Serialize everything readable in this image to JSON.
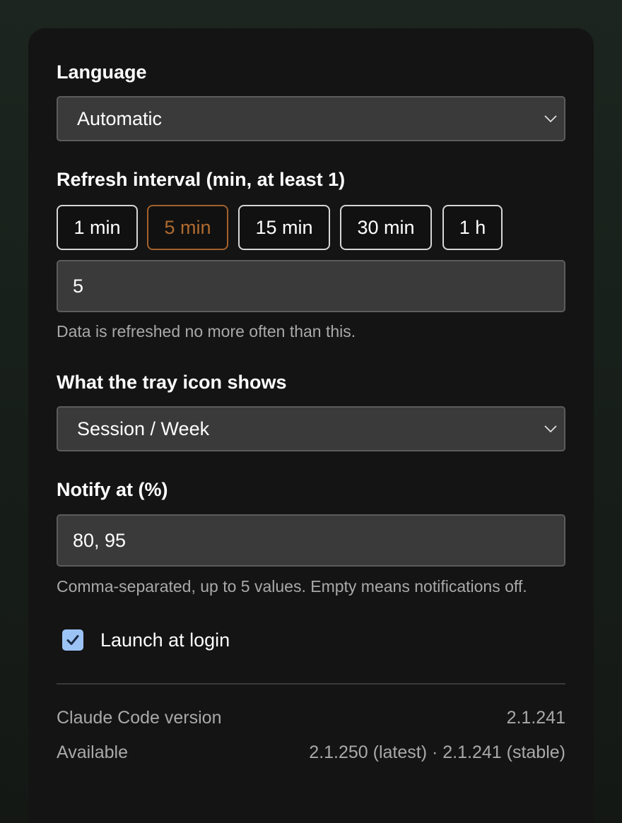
{
  "language": {
    "label": "Language",
    "selected": "Automatic"
  },
  "refresh": {
    "label": "Refresh interval (min, at least 1)",
    "presets": [
      {
        "label": "1 min",
        "active": false
      },
      {
        "label": "5 min",
        "active": true
      },
      {
        "label": "15 min",
        "active": false
      },
      {
        "label": "30 min",
        "active": false
      },
      {
        "label": "1 h",
        "active": false
      }
    ],
    "value": "5",
    "hint": "Data is refreshed no more often than this."
  },
  "tray": {
    "label": "What the tray icon shows",
    "selected": "Session / Week"
  },
  "notify": {
    "label": "Notify at (%)",
    "value": "80, 95",
    "hint": "Comma-separated, up to 5 values. Empty means notifications off."
  },
  "launch": {
    "label": "Launch at login",
    "checked": true
  },
  "version_info": {
    "version_label": "Claude Code version",
    "version_value": "2.1.241",
    "available_label": "Available",
    "available_value": "2.1.250 (latest) · 2.1.241 (stable)"
  },
  "colors": {
    "accent_active": "#b06a2e",
    "checkbox": "#9cc3f5"
  },
  "icons": {
    "select_chevron": "chevron-down-icon",
    "checkbox_mark": "checkmark-icon"
  }
}
